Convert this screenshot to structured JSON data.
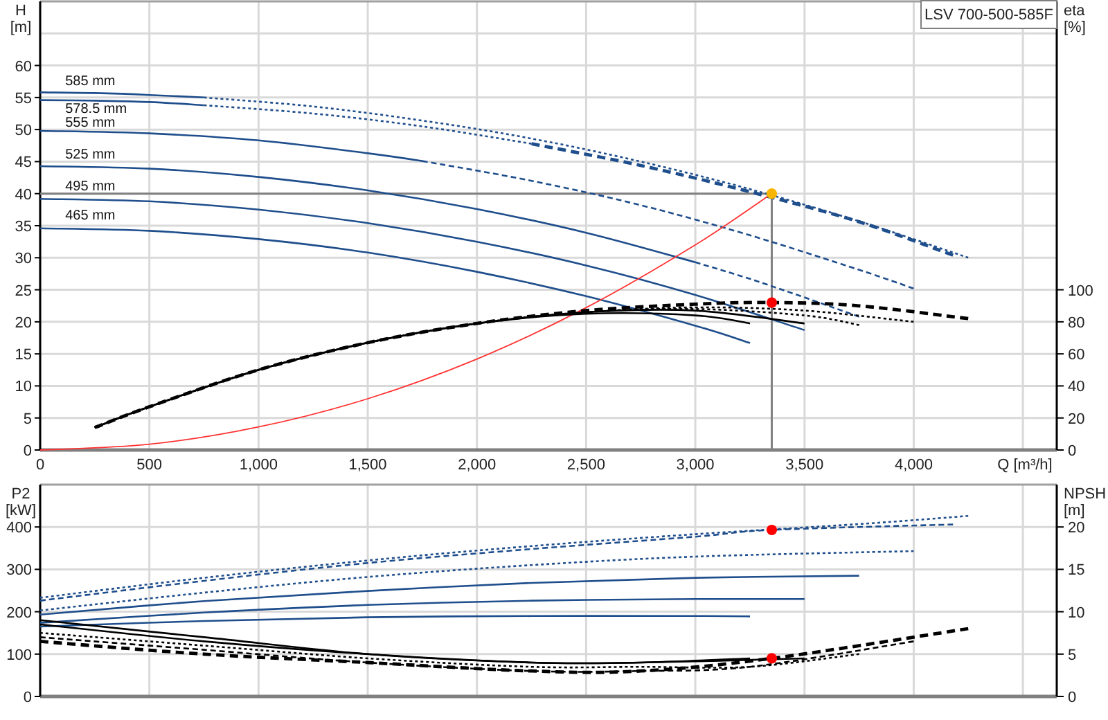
{
  "head_chart": {
    "chart_data": {
      "type": "line",
      "title": "LSV 700-500-585F",
      "xlabel": "Q [m³/h]",
      "ylabel": "H [m]",
      "y2label": "eta [%]",
      "xlim": [
        0,
        4655
      ],
      "ylim": [
        0,
        70
      ],
      "y2lim": [
        0,
        280
      ],
      "grid": true,
      "xticks": [
        {
          "value": 0,
          "label": "0"
        },
        {
          "value": 500,
          "label": "500"
        },
        {
          "value": 1000,
          "label": "1,000"
        },
        {
          "value": 1500,
          "label": "1,500"
        },
        {
          "value": 2000,
          "label": "2,000"
        },
        {
          "value": 2500,
          "label": "2,500"
        },
        {
          "value": 3000,
          "label": "3,000"
        },
        {
          "value": 3500,
          "label": "3,500"
        },
        {
          "value": 4000,
          "label": "4,000"
        }
      ],
      "yticks": [
        0,
        5,
        10,
        15,
        20,
        25,
        30,
        35,
        40,
        45,
        50,
        55,
        60
      ],
      "y2ticks": [
        0,
        20,
        40,
        60,
        80,
        100
      ],
      "series": [
        {
          "color": "#1f4e8c",
          "line_style": "solid",
          "x": [
            0,
            250,
            500,
            750
          ],
          "values": [
            55.8,
            55.7,
            55.4,
            55.0
          ]
        },
        {
          "color": "#1f4e8c",
          "line_style": "dotted",
          "x": [
            750,
            1250,
            1750,
            2250,
            2750,
            3250,
            3750,
            4250
          ],
          "values": [
            55.0,
            53.6,
            51.4,
            48.6,
            45.0,
            40.7,
            35.7,
            30.0
          ]
        },
        {
          "color": "#1f4e8c",
          "line_style": "solid",
          "x": [
            0,
            250,
            500,
            750
          ],
          "values": [
            54.6,
            54.5,
            54.3,
            53.8
          ]
        },
        {
          "color": "#1f4e8c",
          "line_style": "dotted",
          "x": [
            750,
            1250,
            1750,
            2250
          ],
          "values": [
            53.8,
            52.5,
            50.5,
            47.8
          ]
        },
        {
          "color": "#1f4e8c",
          "line_style": "dashed",
          "x": [
            2250,
            2750,
            3250,
            3750,
            4180
          ],
          "values": [
            47.8,
            44.4,
            40.3,
            35.6,
            30.4
          ]
        },
        {
          "color": "#1f4e8c",
          "line_style": "solid",
          "x": [
            0,
            500,
            1000,
            1500,
            1750
          ],
          "values": [
            49.8,
            49.4,
            48.3,
            46.3,
            45.1
          ]
        },
        {
          "color": "#1f4e8c",
          "line_style": "dashed",
          "x": [
            1750,
            2250,
            2750,
            3250,
            3750,
            4000
          ],
          "values": [
            45.1,
            42.0,
            38.2,
            33.5,
            28.1,
            25.2
          ]
        },
        {
          "color": "#1f4e8c",
          "line_style": "solid",
          "x": [
            0,
            500,
            1000,
            1500,
            2000,
            2500,
            3000
          ],
          "values": [
            44.3,
            43.9,
            42.6,
            40.5,
            37.6,
            33.9,
            29.3
          ]
        },
        {
          "color": "#1f4e8c",
          "line_style": "dashed",
          "x": [
            3000,
            3250,
            3500,
            3750
          ],
          "values": [
            29.3,
            26.7,
            23.8,
            20.8
          ]
        },
        {
          "color": "#1f4e8c",
          "line_style": "solid",
          "x": [
            0,
            500,
            1000,
            1500,
            2000,
            2500,
            3000,
            3500
          ],
          "values": [
            39.2,
            38.8,
            37.5,
            35.4,
            32.5,
            28.8,
            24.2,
            18.7
          ]
        },
        {
          "color": "#1f4e8c",
          "line_style": "solid",
          "x": [
            0,
            500,
            1000,
            1500,
            2000,
            2500,
            3000,
            3250
          ],
          "values": [
            34.6,
            34.2,
            32.9,
            30.8,
            27.8,
            24.0,
            19.4,
            16.7
          ]
        },
        {
          "color": "#ff3333",
          "line_style": "solid",
          "x": [
            0,
            500,
            1000,
            1500,
            2000,
            2500,
            3000,
            3350
          ],
          "values": [
            0,
            0.9,
            3.6,
            8.0,
            14.2,
            22.2,
            32.0,
            40.0
          ]
        },
        {
          "color": "#000000",
          "line_style": "solid",
          "axis": "y2",
          "x": [
            250,
            500,
            1000,
            1500,
            2000,
            2500,
            3000,
            3250
          ],
          "values": [
            14,
            27,
            50,
            67,
            79,
            85,
            84,
            79
          ]
        },
        {
          "color": "#000000",
          "line_style": "solid",
          "axis": "y2",
          "x": [
            250,
            500,
            1000,
            1500,
            2000,
            2500,
            3000,
            3500
          ],
          "values": [
            14,
            27,
            50,
            67,
            79,
            86,
            87,
            79
          ]
        },
        {
          "color": "#000000",
          "line_style": "dotted",
          "axis": "y2",
          "x": [
            250,
            500,
            1000,
            1500,
            2000,
            2500,
            3000,
            3500,
            3750
          ],
          "values": [
            14,
            27,
            50,
            67,
            79,
            86,
            88,
            84,
            78
          ]
        },
        {
          "color": "#000000",
          "line_style": "dotted",
          "axis": "y2",
          "x": [
            250,
            500,
            1000,
            1500,
            2000,
            2500,
            3000,
            3500,
            4000
          ],
          "values": [
            14,
            27,
            50,
            67,
            79,
            86,
            89,
            87,
            80
          ]
        },
        {
          "color": "#000000",
          "line_style": "dashed",
          "axis": "y2",
          "x": [
            250,
            500,
            1000,
            1500,
            2000,
            2500,
            3000,
            3350,
            3750,
            4250
          ],
          "values": [
            14,
            27,
            50,
            67,
            79,
            87,
            91,
            92,
            90,
            82
          ]
        },
        {
          "color": "#f7b500",
          "marker": "circle",
          "x": [
            3350
          ],
          "values": [
            40
          ]
        },
        {
          "color": "#ff0000",
          "marker": "circle",
          "axis": "y2",
          "x": [
            3350
          ],
          "values": [
            92
          ]
        }
      ],
      "ref_lines": [
        {
          "axis": "y",
          "value": 40
        },
        {
          "axis": "x",
          "value": 3350
        }
      ],
      "annotations": [
        "585 mm",
        "578.5 mm",
        "555 mm",
        "525 mm",
        "495 mm",
        "465 mm"
      ]
    }
  },
  "power_chart": {
    "chart_data": {
      "type": "line",
      "ylabel": "P2 [kW]",
      "y2label": "NPSH [m]",
      "xlim": [
        0,
        4655
      ],
      "ylim": [
        0,
        500
      ],
      "y2lim": [
        0,
        25
      ],
      "grid": true,
      "yticks": [
        0,
        100,
        200,
        300,
        400
      ],
      "y2ticks": [
        0,
        5,
        10,
        15,
        20
      ],
      "series": [
        {
          "color": "#1f4e8c",
          "line_style": "dotted",
          "x": [
            0,
            750,
            1500,
            2250,
            3000,
            3750,
            4250
          ],
          "values": [
            233,
            280,
            321,
            355,
            383,
            407,
            426
          ]
        },
        {
          "color": "#1f4e8c",
          "line_style": "dashed",
          "x": [
            0,
            750,
            1500,
            2250,
            3000,
            3350,
            4180
          ],
          "values": [
            226,
            273,
            315,
            348,
            377,
            393,
            406
          ]
        },
        {
          "color": "#1f4e8c",
          "line_style": "dotted",
          "x": [
            0,
            750,
            1500,
            2250,
            3000,
            4000
          ],
          "values": [
            203,
            245,
            282,
            310,
            330,
            343
          ]
        },
        {
          "color": "#1f4e8c",
          "line_style": "solid",
          "x": [
            0,
            750,
            1500,
            2250,
            3000,
            3750
          ],
          "values": [
            193,
            225,
            249,
            268,
            280,
            285
          ]
        },
        {
          "color": "#1f4e8c",
          "line_style": "solid",
          "x": [
            0,
            750,
            1500,
            2250,
            3000,
            3500
          ],
          "values": [
            174,
            198,
            216,
            226,
            230,
            230
          ]
        },
        {
          "color": "#1f4e8c",
          "line_style": "solid",
          "x": [
            0,
            750,
            1500,
            2250,
            3000,
            3250
          ],
          "values": [
            165,
            178,
            187,
            190,
            190,
            189
          ]
        },
        {
          "color": "#000000",
          "line_style": "solid",
          "axis": "y2",
          "x": [
            0,
            750,
            1500,
            2250,
            2750,
            3250
          ],
          "values": [
            9,
            7,
            5,
            4,
            4,
            4.5
          ]
        },
        {
          "color": "#000000",
          "line_style": "solid",
          "axis": "y2",
          "x": [
            0,
            750,
            1500,
            2250,
            2750,
            3500
          ],
          "values": [
            8.5,
            6.5,
            5,
            4,
            4,
            4.5
          ]
        },
        {
          "color": "#000000",
          "line_style": "dotted",
          "axis": "y2",
          "x": [
            0,
            750,
            1500,
            2250,
            2750,
            3250,
            3750
          ],
          "values": [
            7.5,
            6,
            4.5,
            3.5,
            3.5,
            3.5,
            5
          ]
        },
        {
          "color": "#000000",
          "line_style": "dashed",
          "axis": "y2",
          "x": [
            0,
            750,
            1500,
            2250,
            2750,
            3250,
            4000
          ],
          "values": [
            7,
            5.5,
            4,
            3,
            3,
            3.5,
            6.5
          ]
        },
        {
          "color": "#000000",
          "line_style": "dashed",
          "axis": "y2",
          "x": [
            0,
            750,
            1500,
            2250,
            2750,
            3350,
            4250
          ],
          "values": [
            6.5,
            5,
            4,
            3,
            3,
            4.5,
            8
          ]
        },
        {
          "color": "#ff0000",
          "marker": "circle",
          "x": [
            3350
          ],
          "values": [
            393
          ]
        },
        {
          "color": "#ff0000",
          "marker": "circle",
          "axis": "y2",
          "x": [
            3350
          ],
          "values": [
            4.5
          ]
        }
      ]
    }
  }
}
